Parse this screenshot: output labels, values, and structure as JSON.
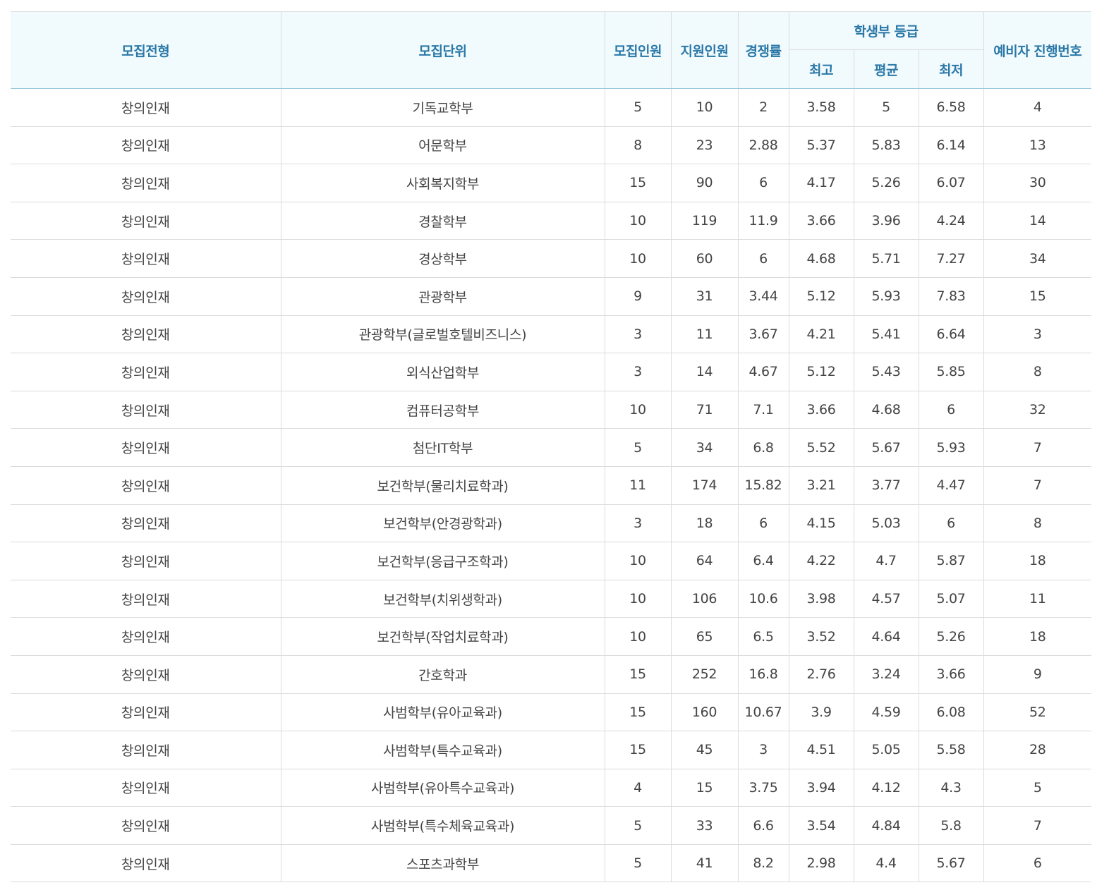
{
  "table": {
    "headers": {
      "type": "모집전형",
      "unit": "모집단위",
      "quota": "모집인원",
      "applicants": "지원인원",
      "ratio": "경쟁률",
      "grade_group": "학생부 등급",
      "grade_max": "최고",
      "grade_avg": "평균",
      "grade_min": "최저",
      "waitlist": "예비자 진행번호"
    },
    "rows": [
      [
        "창의인재",
        "기독교학부",
        "5",
        "10",
        "2",
        "3.58",
        "5",
        "6.58",
        "4"
      ],
      [
        "창의인재",
        "어문학부",
        "8",
        "23",
        "2.88",
        "5.37",
        "5.83",
        "6.14",
        "13"
      ],
      [
        "창의인재",
        "사회복지학부",
        "15",
        "90",
        "6",
        "4.17",
        "5.26",
        "6.07",
        "30"
      ],
      [
        "창의인재",
        "경찰학부",
        "10",
        "119",
        "11.9",
        "3.66",
        "3.96",
        "4.24",
        "14"
      ],
      [
        "창의인재",
        "경상학부",
        "10",
        "60",
        "6",
        "4.68",
        "5.71",
        "7.27",
        "34"
      ],
      [
        "창의인재",
        "관광학부",
        "9",
        "31",
        "3.44",
        "5.12",
        "5.93",
        "7.83",
        "15"
      ],
      [
        "창의인재",
        "관광학부(글로벌호텔비즈니스)",
        "3",
        "11",
        "3.67",
        "4.21",
        "5.41",
        "6.64",
        "3"
      ],
      [
        "창의인재",
        "외식산업학부",
        "3",
        "14",
        "4.67",
        "5.12",
        "5.43",
        "5.85",
        "8"
      ],
      [
        "창의인재",
        "컴퓨터공학부",
        "10",
        "71",
        "7.1",
        "3.66",
        "4.68",
        "6",
        "32"
      ],
      [
        "창의인재",
        "첨단IT학부",
        "5",
        "34",
        "6.8",
        "5.52",
        "5.67",
        "5.93",
        "7"
      ],
      [
        "창의인재",
        "보건학부(물리치료학과)",
        "11",
        "174",
        "15.82",
        "3.21",
        "3.77",
        "4.47",
        "7"
      ],
      [
        "창의인재",
        "보건학부(안경광학과)",
        "3",
        "18",
        "6",
        "4.15",
        "5.03",
        "6",
        "8"
      ],
      [
        "창의인재",
        "보건학부(응급구조학과)",
        "10",
        "64",
        "6.4",
        "4.22",
        "4.7",
        "5.87",
        "18"
      ],
      [
        "창의인재",
        "보건학부(치위생학과)",
        "10",
        "106",
        "10.6",
        "3.98",
        "4.57",
        "5.07",
        "11"
      ],
      [
        "창의인재",
        "보건학부(작업치료학과)",
        "10",
        "65",
        "6.5",
        "3.52",
        "4.64",
        "5.26",
        "18"
      ],
      [
        "창의인재",
        "간호학과",
        "15",
        "252",
        "16.8",
        "2.76",
        "3.24",
        "3.66",
        "9"
      ],
      [
        "창의인재",
        "사범학부(유아교육과)",
        "15",
        "160",
        "10.67",
        "3.9",
        "4.59",
        "6.08",
        "52"
      ],
      [
        "창의인재",
        "사범학부(특수교육과)",
        "15",
        "45",
        "3",
        "4.51",
        "5.05",
        "5.58",
        "28"
      ],
      [
        "창의인재",
        "사범학부(유아특수교육과)",
        "4",
        "15",
        "3.75",
        "3.94",
        "4.12",
        "4.3",
        "5"
      ],
      [
        "창의인재",
        "사범학부(특수체육교육과)",
        "5",
        "33",
        "6.6",
        "3.54",
        "4.84",
        "5.8",
        "7"
      ],
      [
        "창의인재",
        "스포츠과학부",
        "5",
        "41",
        "8.2",
        "2.98",
        "4.4",
        "5.67",
        "6"
      ]
    ]
  },
  "colors": {
    "header_text": "#2a78a8",
    "header_bg": "#f1fafc",
    "body_text": "#444444",
    "grid": "#dcdcdc"
  }
}
